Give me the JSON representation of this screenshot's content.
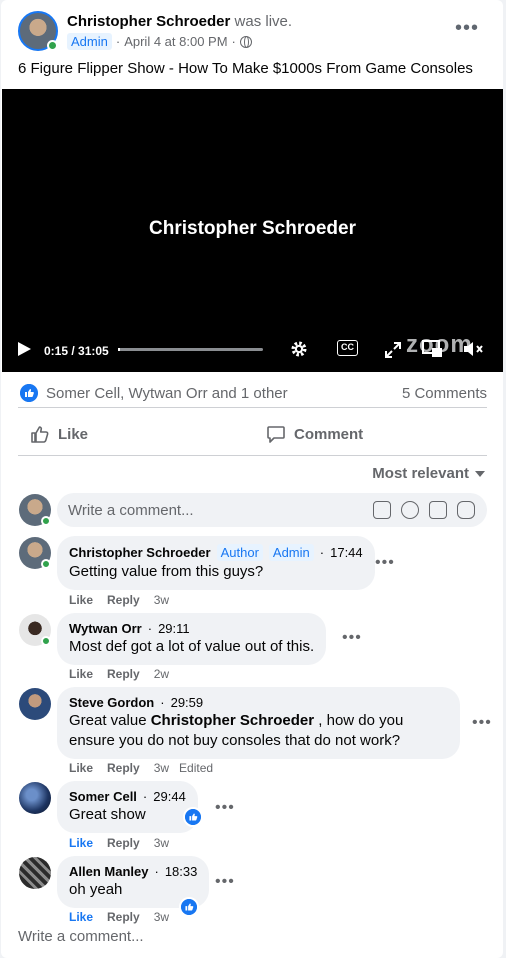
{
  "post": {
    "author": "Christopher Schroeder",
    "status": "was live.",
    "role": "Admin",
    "date": "April 4 at 8:00 PM",
    "dot": "·",
    "title": "6 Figure Flipper Show - How To Make $1000s From Game Consoles"
  },
  "video": {
    "overlay_title": "Christopher Schroeder",
    "time": "0:15 / 31:05",
    "progress": 0.008,
    "cc_label": "CC",
    "zoom_logo": "zoom"
  },
  "reactions": {
    "names": "Somer Cell, Wytwan Orr and 1 other",
    "comments_count": "5 Comments"
  },
  "actions": {
    "like": "Like",
    "comment": "Comment"
  },
  "sort": {
    "label": "Most relevant"
  },
  "writer": {
    "placeholder": "Write a comment..."
  },
  "comments": [
    {
      "name": "Christopher Schroeder",
      "tags": [
        "Author",
        "Admin"
      ],
      "time": "17:44",
      "text": "Getting value from this guys?",
      "like": "Like",
      "reply": "Reply",
      "age": "3w"
    },
    {
      "name": "Wytwan Orr",
      "time": "29:11",
      "text": "Most def got a lot of value out of this.",
      "like": "Like",
      "reply": "Reply",
      "age": "2w"
    },
    {
      "name": "Steve Gordon",
      "time": "29:59",
      "text_pre": "Great value ",
      "text_mention": "Christopher Schroeder",
      "text_post": " , how do you ensure you do not buy consoles that do not work?",
      "like": "Like",
      "reply": "Reply",
      "age": "3w",
      "edited": "Edited"
    },
    {
      "name": "Somer Cell",
      "time": "29:44",
      "text": "Great show",
      "like": "Like",
      "reply": "Reply",
      "age": "3w"
    },
    {
      "name": "Allen Manley",
      "time": "18:33",
      "text": "oh yeah",
      "like": "Like",
      "reply": "Reply",
      "age": "3w"
    }
  ],
  "footer": {
    "placeholder": "Write a comment..."
  },
  "colors": {
    "accent": "#1877f2",
    "online": "#31a24c",
    "muted": "#65676b",
    "bubble": "#f0f2f5"
  },
  "icons": [
    "more-icon",
    "globe-icon",
    "play-icon",
    "settings-icon",
    "cc-icon",
    "fullscreen-icon",
    "pip-icon",
    "volume-icon",
    "like-reaction-icon",
    "like-icon",
    "comment-icon",
    "caret-down-icon",
    "sticker-icon",
    "emoji-icon",
    "camera-icon",
    "gif-icon"
  ]
}
